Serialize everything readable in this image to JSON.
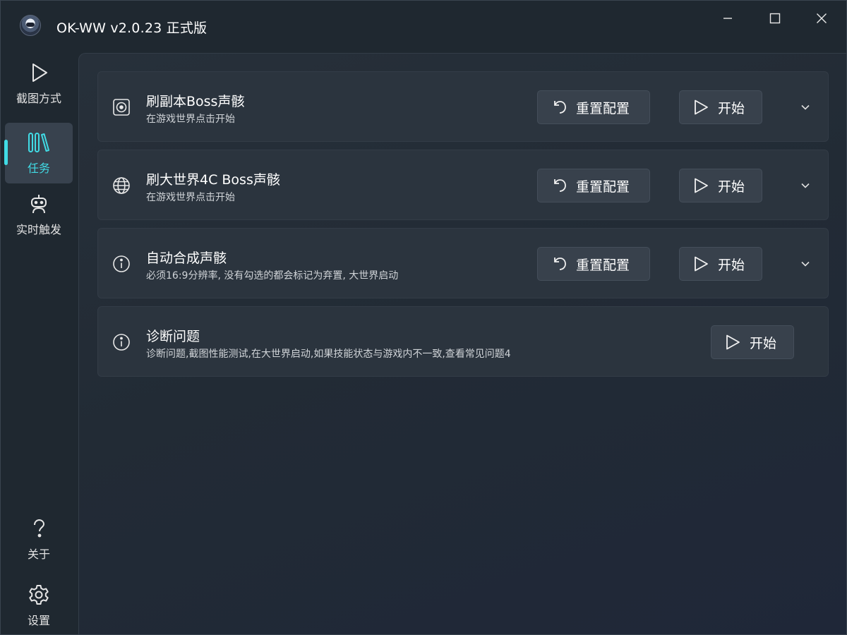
{
  "window": {
    "title": "OK-WW v2.0.23 正式版"
  },
  "colors": {
    "accent": "#41dbe5",
    "background": "#1f2830",
    "card": "#2b343e",
    "button": "#38414c"
  },
  "sidebar": {
    "items": [
      {
        "label": "截图方式",
        "icon": "play-icon",
        "active": false
      },
      {
        "label": "任务",
        "icon": "library-icon",
        "active": true
      },
      {
        "label": "实时触发",
        "icon": "robot-icon",
        "active": false
      }
    ],
    "bottom_items": [
      {
        "label": "关于",
        "icon": "question-icon"
      },
      {
        "label": "设置",
        "icon": "gear-icon"
      }
    ]
  },
  "tasks": [
    {
      "title": "刷副本Boss声骸",
      "subtitle": "在游戏世界点击开始",
      "icon": "target-icon",
      "reset_label": "重置配置",
      "start_label": "开始"
    },
    {
      "title": "刷大世界4C Boss声骸",
      "subtitle": "在游戏世界点击开始",
      "icon": "globe-icon",
      "reset_label": "重置配置",
      "start_label": "开始"
    },
    {
      "title": "自动合成声骸",
      "subtitle": "必须16:9分辨率, 没有勾选的都会标记为弃置, 大世界启动",
      "icon": "info-icon",
      "reset_label": "重置配置",
      "start_label": "开始"
    },
    {
      "title": "诊断问题",
      "subtitle": "诊断问题,截图性能测试,在大世界启动,如果技能状态与游戏内不一致,查看常见问题4",
      "icon": "info-icon",
      "start_label": "开始"
    }
  ]
}
